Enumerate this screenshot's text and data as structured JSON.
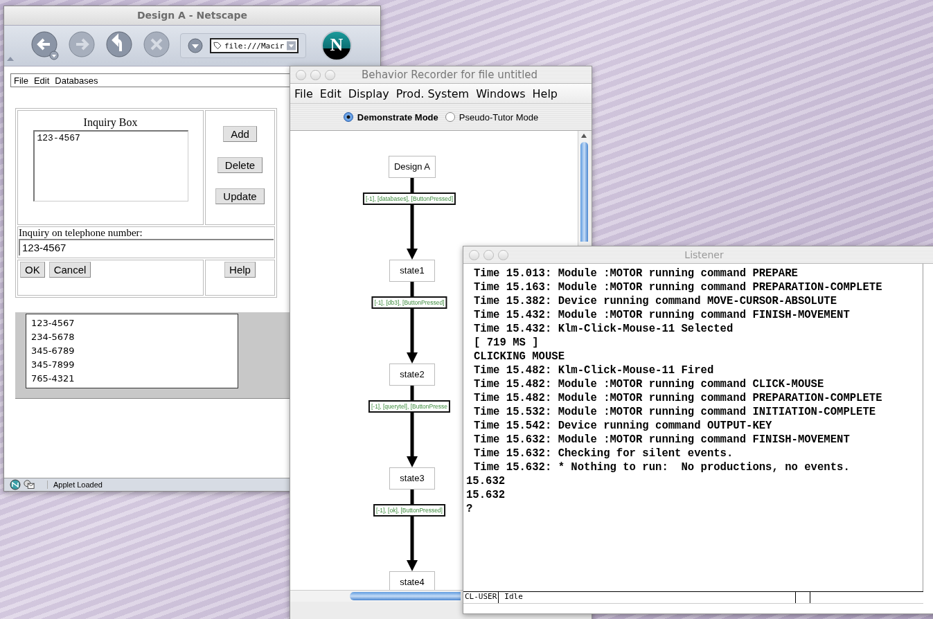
{
  "browser_window": {
    "title": "Design A - Netscape",
    "url": "file:///Macir",
    "logo": "N",
    "menu": [
      "File",
      "Edit",
      "Databases"
    ],
    "inquiry_box": {
      "title": "Inquiry Box",
      "value": "123-4567"
    },
    "side_buttons": [
      "Add",
      "Delete",
      "Update"
    ],
    "inquiry_field": {
      "label": "Inquiry on telephone number:",
      "value": "123-4567"
    },
    "action_buttons": [
      "OK",
      "Cancel"
    ],
    "help_button": "Help",
    "numbers": [
      {
        "text": "123-4567",
        "selected": false
      },
      {
        "text": "234-5678",
        "selected": false
      },
      {
        "text": "345-6789",
        "selected": false
      },
      {
        "text": "345-7899",
        "selected": false
      },
      {
        "text": "765-4321",
        "selected": false
      }
    ],
    "status": "Applet Loaded"
  },
  "recorder_window": {
    "title": "Behavior Recorder for file untitled",
    "menu": [
      "File",
      "Edit",
      "Display",
      "Prod. System",
      "Windows",
      "Help"
    ],
    "modes": [
      {
        "label": "Demonstrate Mode",
        "selected": true
      },
      {
        "label": "Pseudo-Tutor Mode",
        "selected": false
      }
    ],
    "nodes": [
      "Design A",
      "state1",
      "state2",
      "state3",
      "state4"
    ],
    "edges": [
      "[-1], [databases], [ButtonPressed]",
      "[-1], [db3], [ButtonPressed]",
      "[-1], [querytel], [ButtonPresse",
      "[-1], [ok], [ButtonPressed]"
    ]
  },
  "listener_window": {
    "title": "Listener",
    "lines": [
      {
        "kind": "trace",
        "text": "Time 15.013: Module :MOTOR running command PREPARE"
      },
      {
        "kind": "trace",
        "text": "Time 15.163: Module :MOTOR running command PREPARATION-COMPLETE"
      },
      {
        "kind": "trace",
        "text": "Time 15.382: Device running command MOVE-CURSOR-ABSOLUTE"
      },
      {
        "kind": "trace",
        "text": "Time 15.432: Module :MOTOR running command FINISH-MOVEMENT"
      },
      {
        "kind": "trace",
        "text": "Time 15.432: Klm-Click-Mouse-11 Selected"
      },
      {
        "kind": "trace",
        "text": "[ 719 MS ]"
      },
      {
        "kind": "trace",
        "text": "CLICKING MOUSE"
      },
      {
        "kind": "trace",
        "text": "Time 15.482: Klm-Click-Mouse-11 Fired"
      },
      {
        "kind": "trace",
        "text": "Time 15.482: Module :MOTOR running command CLICK-MOUSE"
      },
      {
        "kind": "trace",
        "text": "Time 15.482: Module :MOTOR running command PREPARATION-COMPLETE"
      },
      {
        "kind": "trace",
        "text": "Time 15.532: Module :MOTOR running command INITIATION-COMPLETE"
      },
      {
        "kind": "trace",
        "text": "Time 15.542: Device running command OUTPUT-KEY"
      },
      {
        "kind": "trace",
        "text": "Time 15.632: Module :MOTOR running command FINISH-MOVEMENT"
      },
      {
        "kind": "trace",
        "text": "Time 15.632: Checking for silent events."
      },
      {
        "kind": "trace",
        "text": "Time 15.632: * Nothing to run:  No productions, no events."
      },
      {
        "kind": "result",
        "text": "15.632"
      },
      {
        "kind": "result",
        "text": "15.632"
      },
      {
        "kind": "result",
        "text": "?"
      }
    ],
    "status": {
      "package": "CL-USER",
      "state": "Idle"
    }
  }
}
